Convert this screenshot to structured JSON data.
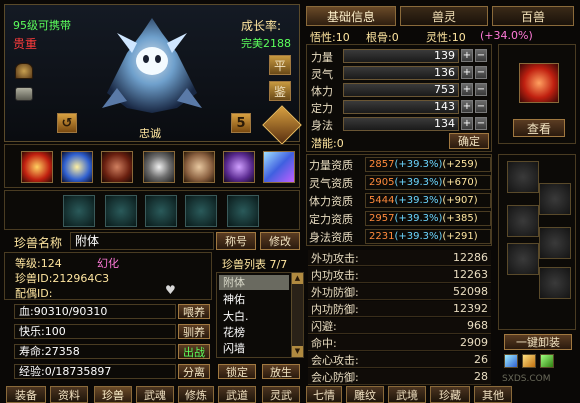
{
  "pet": {
    "level_text": "95级可携带",
    "rarity": "贵重",
    "growth_label": "成长率:",
    "growth_value": "完美2188",
    "loyalty": "忠诚",
    "num_badge": "5",
    "btn_ping": "平",
    "btn_jian": "鉴"
  },
  "tabs": {
    "basic": "基础信息",
    "spirit": "兽灵",
    "beasts": "百兽"
  },
  "top_stats": {
    "wuxing_label": "悟性:10",
    "gengu_label": "根骨:0",
    "lingxing_label": "灵性:10",
    "lingxing_bonus": "(+34.0%)"
  },
  "attributes": [
    {
      "label": "力量",
      "value": "139"
    },
    {
      "label": "灵气",
      "value": "136"
    },
    {
      "label": "体力",
      "value": "753"
    },
    {
      "label": "定力",
      "value": "143"
    },
    {
      "label": "身法",
      "value": "134"
    }
  ],
  "potential": "潜能:0",
  "confirm": "确定",
  "view": "查看",
  "aptitudes": [
    {
      "label": "力量资质",
      "base": "2857",
      "pct": "(+39.3%)",
      "plus": "(+259)"
    },
    {
      "label": "灵气资质",
      "base": "2905",
      "pct": "(+39.3%)",
      "plus": "(+670)"
    },
    {
      "label": "体力资质",
      "base": "5444",
      "pct": "(+39.3%)",
      "plus": "(+907)"
    },
    {
      "label": "定力资质",
      "base": "2957",
      "pct": "(+39.3%)",
      "plus": "(+385)"
    },
    {
      "label": "身法资质",
      "base": "2231",
      "pct": "(+39.3%)",
      "plus": "(+291)"
    }
  ],
  "name_section": {
    "label": "珍兽名称",
    "value": "附体",
    "title_btn": "称号",
    "modify_btn": "修改"
  },
  "info": {
    "level": "等级:124",
    "phantom": "幻化",
    "pet_id": "珍兽ID:212964C3",
    "mate": "配偶ID:"
  },
  "list": {
    "title": "珍兽列表 7/7",
    "items": [
      "附体",
      "神佑",
      "大白.",
      "花榜",
      "闪墙"
    ]
  },
  "bars": [
    {
      "label": "血:90310/90310",
      "btn": "喂养"
    },
    {
      "label": "快乐:100",
      "btn": "驯养"
    },
    {
      "label": "寿命:27358",
      "btn": "出战"
    },
    {
      "label": "经验:0/18735897",
      "btn": "分离"
    }
  ],
  "lock_btn": "锁定",
  "release_btn": "放生",
  "combat_stats": [
    {
      "label": "外功攻击:",
      "value": "12286"
    },
    {
      "label": "内功攻击:",
      "value": "12263"
    },
    {
      "label": "外功防御:",
      "value": "52098"
    },
    {
      "label": "内功防御:",
      "value": "12392"
    },
    {
      "label": "闪避:",
      "value": "968"
    },
    {
      "label": "命中:",
      "value": "2909"
    },
    {
      "label": "会心攻击:",
      "value": "26"
    },
    {
      "label": "会心防御:",
      "value": "28"
    }
  ],
  "unequip_all": "一键卸装",
  "bottom_tabs": [
    "装备",
    "资料",
    "珍兽",
    "武魂",
    "修炼",
    "武道",
    "灵武",
    "七情",
    "雕纹",
    "武境",
    "珍藏",
    "其他"
  ],
  "watermark": "SXDS.COM"
}
